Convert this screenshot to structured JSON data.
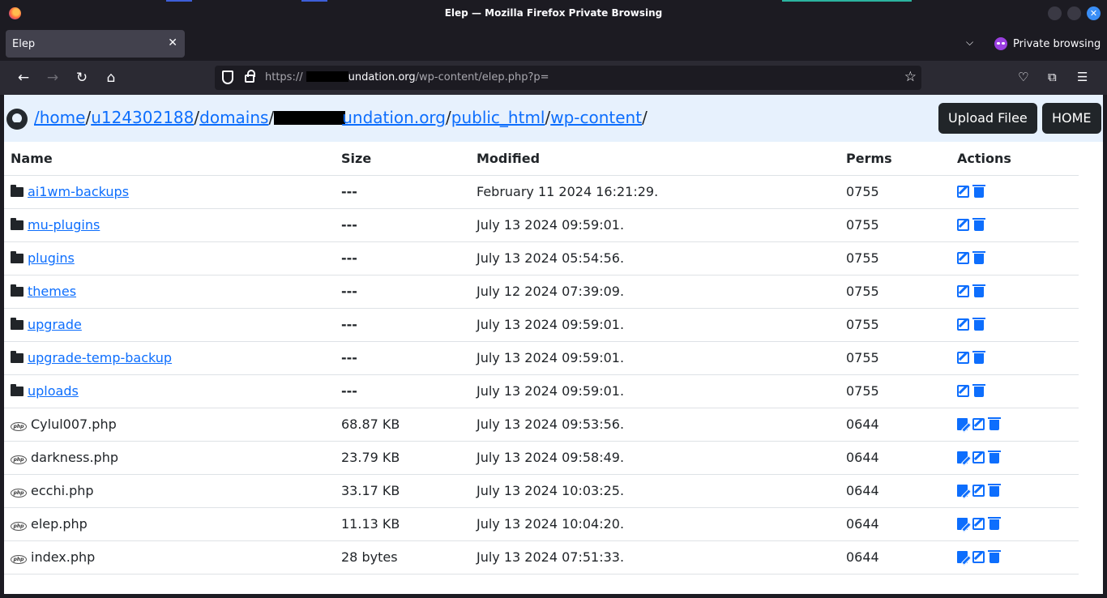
{
  "window": {
    "title": "Elep — Mozilla Firefox Private Browsing"
  },
  "tab": {
    "title": "Elep",
    "close": "✕"
  },
  "toolbar": {
    "private_label": "Private browsing"
  },
  "url": {
    "scheme": "https://",
    "host_rest": "undation.org",
    "path": "/wp-content/elep.php?p="
  },
  "breadcrumb": {
    "segments": [
      "/home",
      "u124302188",
      "domains",
      "undation.org",
      "public_html",
      "wp-content"
    ],
    "trailing": "/"
  },
  "buttons": {
    "upload": "Upload Filee",
    "home": "HOME"
  },
  "table": {
    "headers": {
      "name": "Name",
      "size": "Size",
      "modified": "Modified",
      "perms": "Perms",
      "actions": "Actions"
    },
    "rows": [
      {
        "name": "ai1wm-backups",
        "size": "---",
        "modified": "February 11 2024 16:21:29.",
        "perms": "0755",
        "type": "dir"
      },
      {
        "name": "mu-plugins",
        "size": "---",
        "modified": "July 13 2024 09:59:01.",
        "perms": "0755",
        "type": "dir"
      },
      {
        "name": "plugins",
        "size": "---",
        "modified": "July 13 2024 05:54:56.",
        "perms": "0755",
        "type": "dir"
      },
      {
        "name": "themes",
        "size": "---",
        "modified": "July 12 2024 07:39:09.",
        "perms": "0755",
        "type": "dir"
      },
      {
        "name": "upgrade",
        "size": "---",
        "modified": "July 13 2024 09:59:01.",
        "perms": "0755",
        "type": "dir"
      },
      {
        "name": "upgrade-temp-backup",
        "size": "---",
        "modified": "July 13 2024 09:59:01.",
        "perms": "0755",
        "type": "dir"
      },
      {
        "name": "uploads",
        "size": "---",
        "modified": "July 13 2024 09:59:01.",
        "perms": "0755",
        "type": "dir"
      },
      {
        "name": "Cylul007.php",
        "size": "68.87 KB",
        "modified": "July 13 2024 09:53:56.",
        "perms": "0644",
        "type": "file"
      },
      {
        "name": "darkness.php",
        "size": "23.79 KB",
        "modified": "July 13 2024 09:58:49.",
        "perms": "0644",
        "type": "file"
      },
      {
        "name": "ecchi.php",
        "size": "33.17 KB",
        "modified": "July 13 2024 10:03:25.",
        "perms": "0644",
        "type": "file"
      },
      {
        "name": "elep.php",
        "size": "11.13 KB",
        "modified": "July 13 2024 10:04:20.",
        "perms": "0644",
        "type": "file"
      },
      {
        "name": "index.php",
        "size": "28 bytes",
        "modified": "July 13 2024 07:51:33.",
        "perms": "0644",
        "type": "file"
      }
    ]
  }
}
